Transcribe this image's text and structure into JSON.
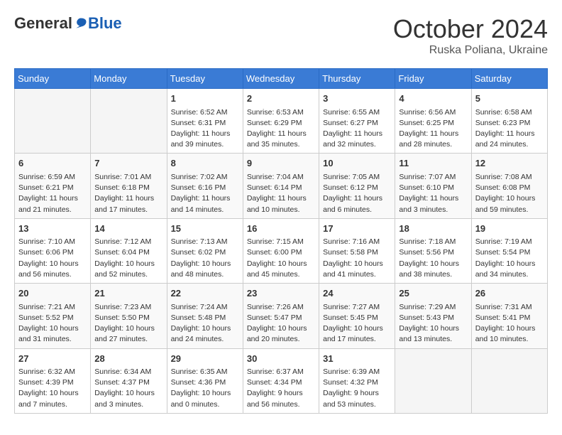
{
  "header": {
    "logo_general": "General",
    "logo_blue": "Blue",
    "month_title": "October 2024",
    "subtitle": "Ruska Poliana, Ukraine"
  },
  "days_of_week": [
    "Sunday",
    "Monday",
    "Tuesday",
    "Wednesday",
    "Thursday",
    "Friday",
    "Saturday"
  ],
  "weeks": [
    [
      {
        "day": "",
        "empty": true
      },
      {
        "day": "",
        "empty": true
      },
      {
        "day": "1",
        "sunrise": "Sunrise: 6:52 AM",
        "sunset": "Sunset: 6:31 PM",
        "daylight": "Daylight: 11 hours and 39 minutes."
      },
      {
        "day": "2",
        "sunrise": "Sunrise: 6:53 AM",
        "sunset": "Sunset: 6:29 PM",
        "daylight": "Daylight: 11 hours and 35 minutes."
      },
      {
        "day": "3",
        "sunrise": "Sunrise: 6:55 AM",
        "sunset": "Sunset: 6:27 PM",
        "daylight": "Daylight: 11 hours and 32 minutes."
      },
      {
        "day": "4",
        "sunrise": "Sunrise: 6:56 AM",
        "sunset": "Sunset: 6:25 PM",
        "daylight": "Daylight: 11 hours and 28 minutes."
      },
      {
        "day": "5",
        "sunrise": "Sunrise: 6:58 AM",
        "sunset": "Sunset: 6:23 PM",
        "daylight": "Daylight: 11 hours and 24 minutes."
      }
    ],
    [
      {
        "day": "6",
        "sunrise": "Sunrise: 6:59 AM",
        "sunset": "Sunset: 6:21 PM",
        "daylight": "Daylight: 11 hours and 21 minutes."
      },
      {
        "day": "7",
        "sunrise": "Sunrise: 7:01 AM",
        "sunset": "Sunset: 6:18 PM",
        "daylight": "Daylight: 11 hours and 17 minutes."
      },
      {
        "day": "8",
        "sunrise": "Sunrise: 7:02 AM",
        "sunset": "Sunset: 6:16 PM",
        "daylight": "Daylight: 11 hours and 14 minutes."
      },
      {
        "day": "9",
        "sunrise": "Sunrise: 7:04 AM",
        "sunset": "Sunset: 6:14 PM",
        "daylight": "Daylight: 11 hours and 10 minutes."
      },
      {
        "day": "10",
        "sunrise": "Sunrise: 7:05 AM",
        "sunset": "Sunset: 6:12 PM",
        "daylight": "Daylight: 11 hours and 6 minutes."
      },
      {
        "day": "11",
        "sunrise": "Sunrise: 7:07 AM",
        "sunset": "Sunset: 6:10 PM",
        "daylight": "Daylight: 11 hours and 3 minutes."
      },
      {
        "day": "12",
        "sunrise": "Sunrise: 7:08 AM",
        "sunset": "Sunset: 6:08 PM",
        "daylight": "Daylight: 10 hours and 59 minutes."
      }
    ],
    [
      {
        "day": "13",
        "sunrise": "Sunrise: 7:10 AM",
        "sunset": "Sunset: 6:06 PM",
        "daylight": "Daylight: 10 hours and 56 minutes."
      },
      {
        "day": "14",
        "sunrise": "Sunrise: 7:12 AM",
        "sunset": "Sunset: 6:04 PM",
        "daylight": "Daylight: 10 hours and 52 minutes."
      },
      {
        "day": "15",
        "sunrise": "Sunrise: 7:13 AM",
        "sunset": "Sunset: 6:02 PM",
        "daylight": "Daylight: 10 hours and 48 minutes."
      },
      {
        "day": "16",
        "sunrise": "Sunrise: 7:15 AM",
        "sunset": "Sunset: 6:00 PM",
        "daylight": "Daylight: 10 hours and 45 minutes."
      },
      {
        "day": "17",
        "sunrise": "Sunrise: 7:16 AM",
        "sunset": "Sunset: 5:58 PM",
        "daylight": "Daylight: 10 hours and 41 minutes."
      },
      {
        "day": "18",
        "sunrise": "Sunrise: 7:18 AM",
        "sunset": "Sunset: 5:56 PM",
        "daylight": "Daylight: 10 hours and 38 minutes."
      },
      {
        "day": "19",
        "sunrise": "Sunrise: 7:19 AM",
        "sunset": "Sunset: 5:54 PM",
        "daylight": "Daylight: 10 hours and 34 minutes."
      }
    ],
    [
      {
        "day": "20",
        "sunrise": "Sunrise: 7:21 AM",
        "sunset": "Sunset: 5:52 PM",
        "daylight": "Daylight: 10 hours and 31 minutes."
      },
      {
        "day": "21",
        "sunrise": "Sunrise: 7:23 AM",
        "sunset": "Sunset: 5:50 PM",
        "daylight": "Daylight: 10 hours and 27 minutes."
      },
      {
        "day": "22",
        "sunrise": "Sunrise: 7:24 AM",
        "sunset": "Sunset: 5:48 PM",
        "daylight": "Daylight: 10 hours and 24 minutes."
      },
      {
        "day": "23",
        "sunrise": "Sunrise: 7:26 AM",
        "sunset": "Sunset: 5:47 PM",
        "daylight": "Daylight: 10 hours and 20 minutes."
      },
      {
        "day": "24",
        "sunrise": "Sunrise: 7:27 AM",
        "sunset": "Sunset: 5:45 PM",
        "daylight": "Daylight: 10 hours and 17 minutes."
      },
      {
        "day": "25",
        "sunrise": "Sunrise: 7:29 AM",
        "sunset": "Sunset: 5:43 PM",
        "daylight": "Daylight: 10 hours and 13 minutes."
      },
      {
        "day": "26",
        "sunrise": "Sunrise: 7:31 AM",
        "sunset": "Sunset: 5:41 PM",
        "daylight": "Daylight: 10 hours and 10 minutes."
      }
    ],
    [
      {
        "day": "27",
        "sunrise": "Sunrise: 6:32 AM",
        "sunset": "Sunset: 4:39 PM",
        "daylight": "Daylight: 10 hours and 7 minutes."
      },
      {
        "day": "28",
        "sunrise": "Sunrise: 6:34 AM",
        "sunset": "Sunset: 4:37 PM",
        "daylight": "Daylight: 10 hours and 3 minutes."
      },
      {
        "day": "29",
        "sunrise": "Sunrise: 6:35 AM",
        "sunset": "Sunset: 4:36 PM",
        "daylight": "Daylight: 10 hours and 0 minutes."
      },
      {
        "day": "30",
        "sunrise": "Sunrise: 6:37 AM",
        "sunset": "Sunset: 4:34 PM",
        "daylight": "Daylight: 9 hours and 56 minutes."
      },
      {
        "day": "31",
        "sunrise": "Sunrise: 6:39 AM",
        "sunset": "Sunset: 4:32 PM",
        "daylight": "Daylight: 9 hours and 53 minutes."
      },
      {
        "day": "",
        "empty": true
      },
      {
        "day": "",
        "empty": true
      }
    ]
  ]
}
